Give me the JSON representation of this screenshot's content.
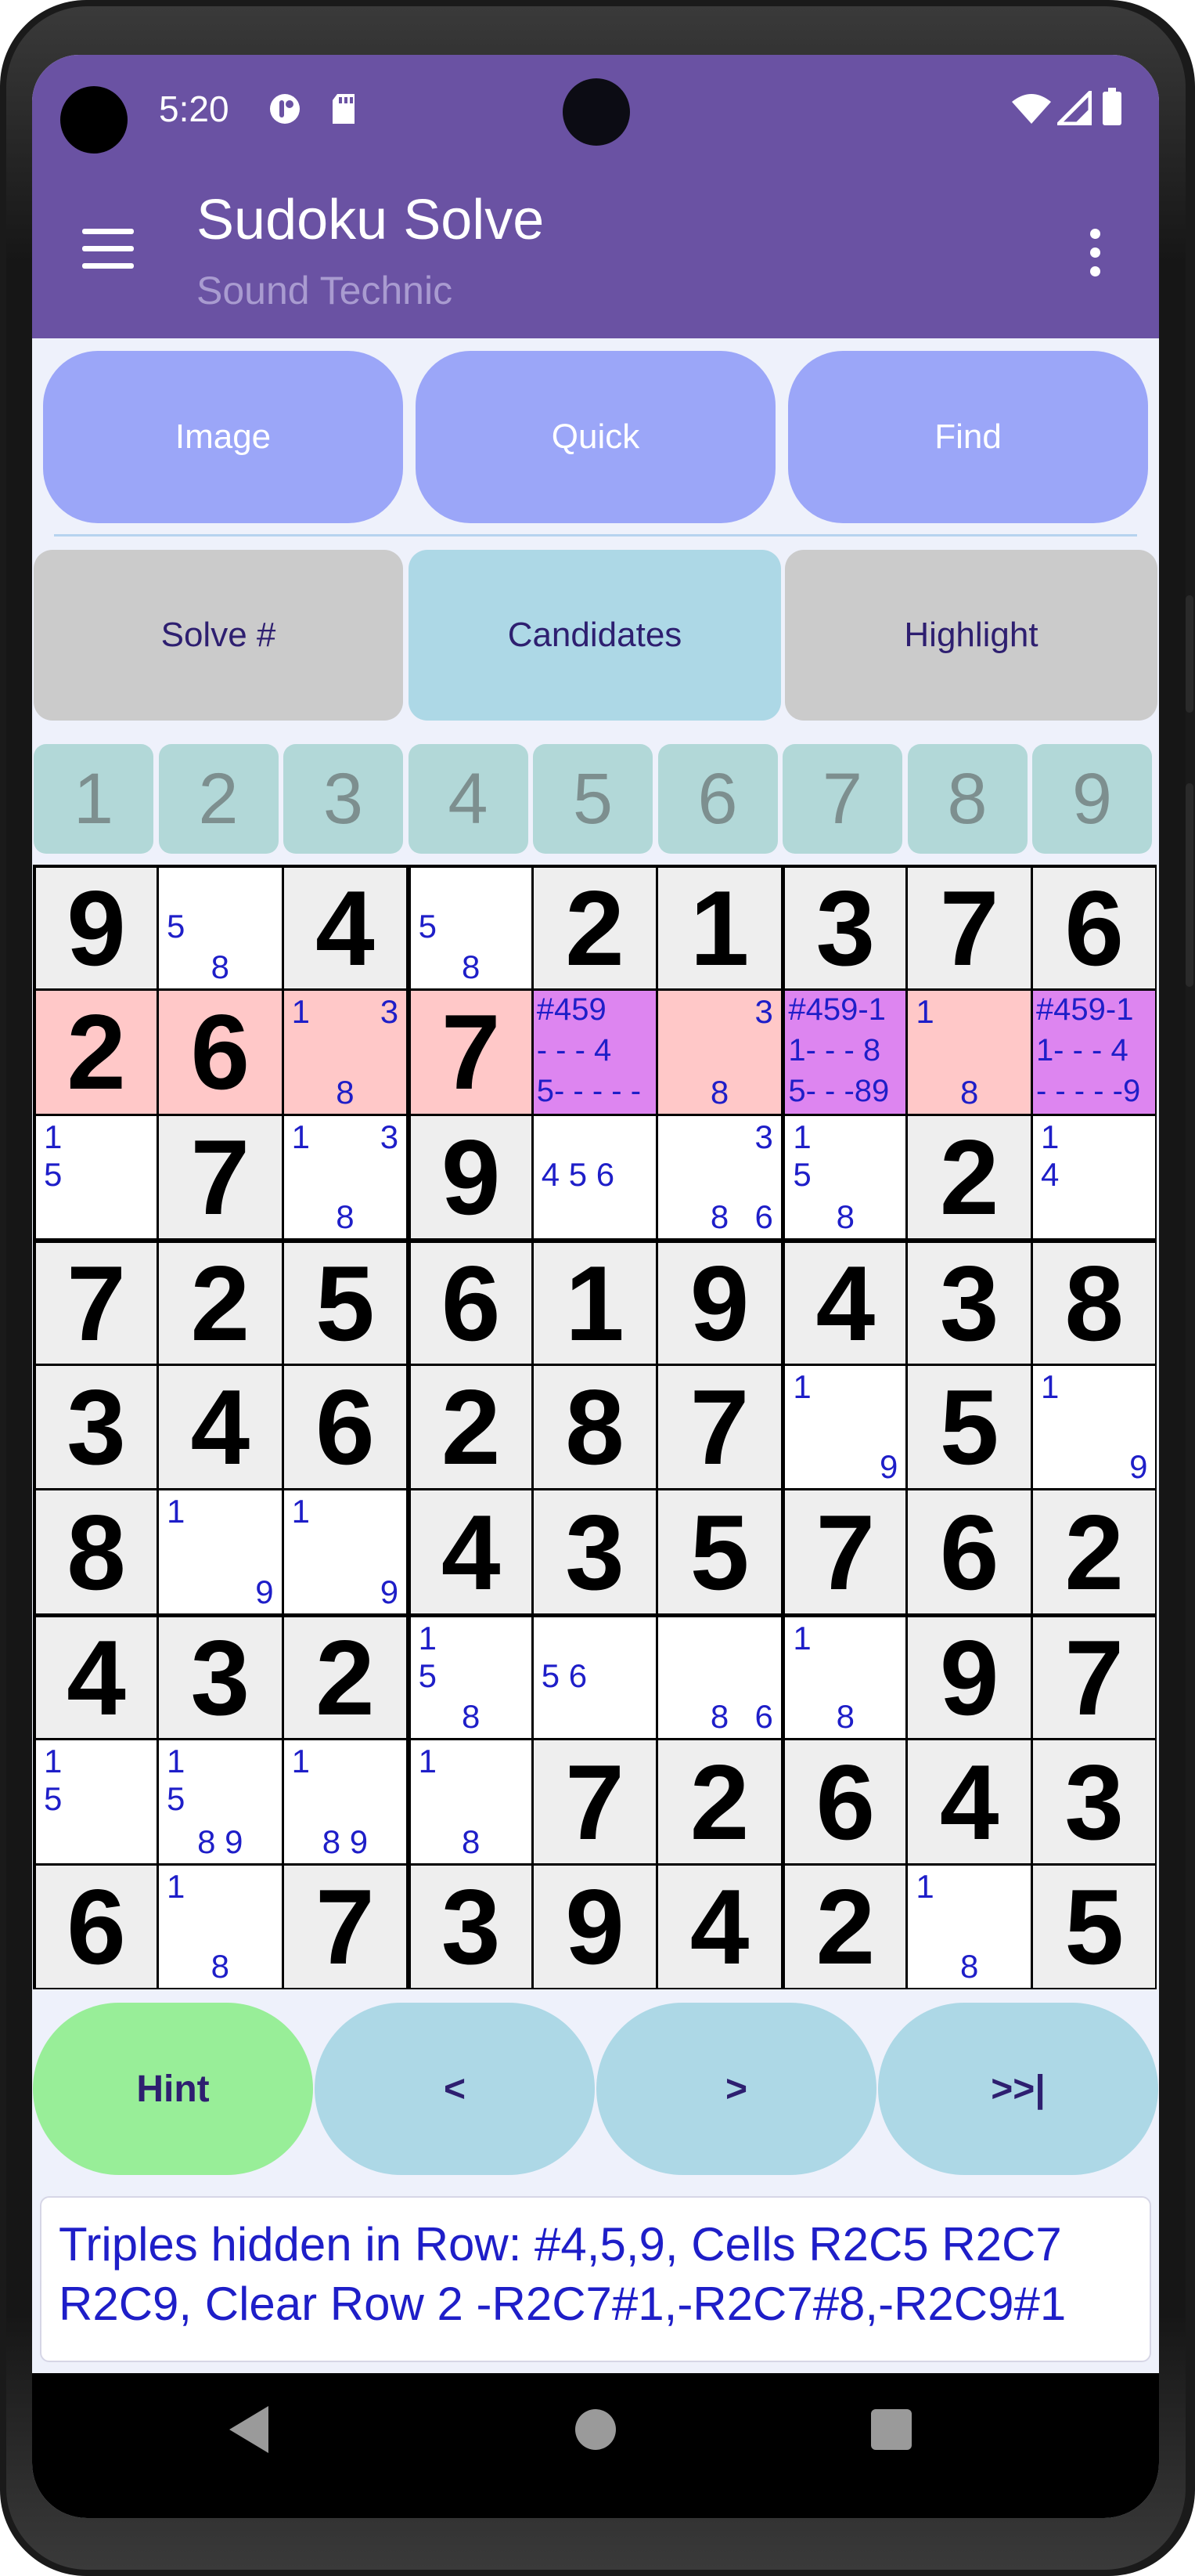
{
  "status_bar": {
    "time": "5:20"
  },
  "app_bar": {
    "title": "Sudoku Solve",
    "subtitle": "Sound Technic"
  },
  "top_buttons": [
    "Image",
    "Quick",
    "Find"
  ],
  "mode_buttons": [
    {
      "label": "Solve #",
      "active": false
    },
    {
      "label": "Candidates",
      "active": true
    },
    {
      "label": "Highlight",
      "active": false
    }
  ],
  "number_keys": [
    "1",
    "2",
    "3",
    "4",
    "5",
    "6",
    "7",
    "8",
    "9"
  ],
  "grid": {
    "rows": [
      [
        {
          "v": "9"
        },
        {
          "c": [
            "",
            "5",
            "",
            "",
            "8"
          ]
        },
        {
          "v": "4"
        },
        {
          "c": [
            "",
            "5",
            "",
            "",
            "8"
          ]
        },
        {
          "v": "2"
        },
        {
          "v": "1"
        },
        {
          "v": "3"
        },
        {
          "v": "7"
        },
        {
          "v": "6"
        }
      ],
      [
        {
          "v": "2",
          "h": "r"
        },
        {
          "v": "6",
          "h": "r"
        },
        {
          "c": [
            "1",
            "",
            "3",
            "",
            "8"
          ],
          "h": "r"
        },
        {
          "v": "7",
          "h": "r"
        },
        {
          "t": [
            "#459",
            "- - - 4",
            "5- - - - -"
          ],
          "h": "m"
        },
        {
          "c": [
            "",
            "",
            "3",
            "",
            "8"
          ],
          "h": "r"
        },
        {
          "t": [
            "#459-1",
            "1- - - 8",
            "5- - -89"
          ],
          "h": "m"
        },
        {
          "c": [
            "1",
            "",
            "",
            "",
            "8"
          ],
          "h": "r"
        },
        {
          "t": [
            "#459-1",
            "1- - - 4",
            "- - - - -9"
          ],
          "h": "m"
        }
      ],
      [
        {
          "c": [
            "1",
            "5"
          ]
        },
        {
          "v": "7"
        },
        {
          "c": [
            "1",
            "",
            "3",
            "",
            "8"
          ]
        },
        {
          "v": "9"
        },
        {
          "c": [
            "",
            "4 5 6"
          ]
        },
        {
          "c": [
            "",
            "",
            "3",
            "6",
            "8"
          ]
        },
        {
          "c": [
            "1",
            "5",
            "",
            "",
            "8"
          ]
        },
        {
          "v": "2"
        },
        {
          "c": [
            "1",
            "4"
          ]
        }
      ],
      [
        {
          "v": "7"
        },
        {
          "v": "2"
        },
        {
          "v": "5"
        },
        {
          "v": "6"
        },
        {
          "v": "1"
        },
        {
          "v": "9"
        },
        {
          "v": "4"
        },
        {
          "v": "3"
        },
        {
          "v": "8"
        }
      ],
      [
        {
          "v": "3"
        },
        {
          "v": "4"
        },
        {
          "v": "6"
        },
        {
          "v": "2"
        },
        {
          "v": "8"
        },
        {
          "v": "7"
        },
        {
          "c": [
            "1",
            "",
            "",
            "9"
          ]
        },
        {
          "v": "5"
        },
        {
          "c": [
            "1",
            "",
            "",
            "9"
          ]
        }
      ],
      [
        {
          "v": "8"
        },
        {
          "c": [
            "1",
            "",
            "",
            "9"
          ]
        },
        {
          "c": [
            "1",
            "",
            "",
            "9"
          ]
        },
        {
          "v": "4"
        },
        {
          "v": "3"
        },
        {
          "v": "5"
        },
        {
          "v": "7"
        },
        {
          "v": "6"
        },
        {
          "v": "2"
        }
      ],
      [
        {
          "v": "4"
        },
        {
          "v": "3"
        },
        {
          "v": "2"
        },
        {
          "c": [
            "1",
            "5",
            "",
            "",
            "8"
          ]
        },
        {
          "c": [
            "",
            "5 6"
          ]
        },
        {
          "c": [
            "",
            "",
            "",
            "6",
            "8"
          ]
        },
        {
          "c": [
            "1",
            "",
            "",
            "",
            "8"
          ]
        },
        {
          "v": "9"
        },
        {
          "v": "7"
        }
      ],
      [
        {
          "c": [
            "1",
            "5"
          ]
        },
        {
          "c": [
            "1",
            "5",
            "",
            "",
            "8 9"
          ]
        },
        {
          "c": [
            "1",
            "",
            "",
            "",
            "8 9"
          ]
        },
        {
          "c": [
            "1",
            "",
            "",
            "",
            "8"
          ]
        },
        {
          "v": "7"
        },
        {
          "v": "2"
        },
        {
          "v": "6"
        },
        {
          "v": "4"
        },
        {
          "v": "3"
        }
      ],
      [
        {
          "v": "6"
        },
        {
          "c": [
            "1",
            "",
            "",
            "",
            "8"
          ]
        },
        {
          "v": "7"
        },
        {
          "v": "3"
        },
        {
          "v": "9"
        },
        {
          "v": "4"
        },
        {
          "v": "2"
        },
        {
          "c": [
            "1",
            "",
            "",
            "",
            "8"
          ]
        },
        {
          "v": "5"
        }
      ]
    ]
  },
  "action_buttons": [
    "Hint",
    "<",
    ">",
    ">>|"
  ],
  "message": "Triples hidden in Row: #4,5,9, Cells R2C5 R2C7 R2C9, Clear Row 2 -R2C7#1,-R2C7#8,-R2C9#1",
  "colors": {
    "app_bar": "#6a52a3",
    "pill_button": "#9ba6f8",
    "mode_active": "#add8e6",
    "mode_inactive": "#cbcbcb",
    "number_key": "#b2d8d8",
    "row_highlight": "#ffc8c8",
    "triple_highlight": "#dd85f0",
    "candidate_text": "#1e1ec8",
    "hint_button": "#98ee98",
    "nav_button": "#add8e6"
  },
  "icons": [
    "menu-icon",
    "overflow-menu-icon",
    "wifi-icon",
    "signal-icon",
    "battery-icon",
    "sd-card-icon",
    "notification-icon",
    "back-nav-icon",
    "home-nav-icon",
    "recents-nav-icon"
  ]
}
